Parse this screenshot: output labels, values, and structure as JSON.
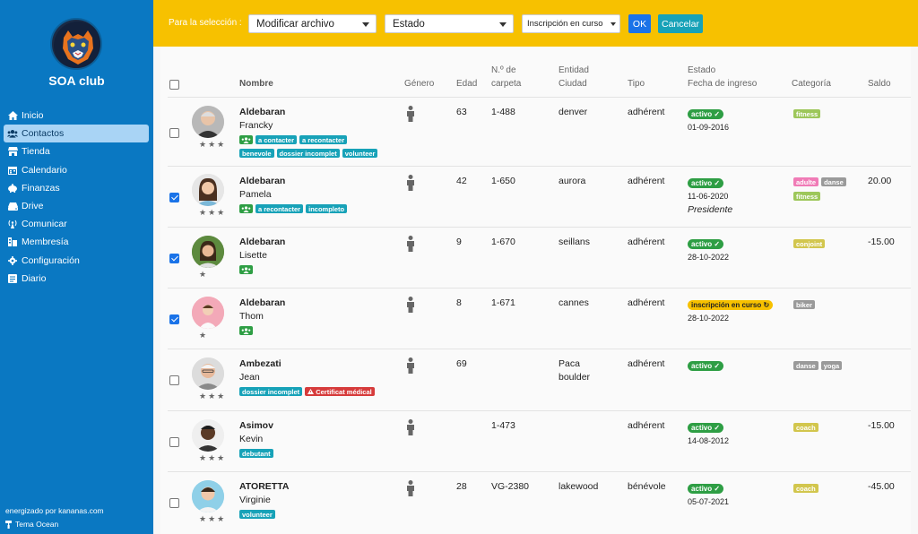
{
  "sidebar": {
    "brand": "SOA club",
    "items": [
      {
        "label": "Inicio",
        "icon": "home-icon"
      },
      {
        "label": "Contactos",
        "icon": "users-icon"
      },
      {
        "label": "Tienda",
        "icon": "store-icon"
      },
      {
        "label": "Calendario",
        "icon": "calendar-icon"
      },
      {
        "label": "Finanzas",
        "icon": "piggy-bank-icon"
      },
      {
        "label": "Drive",
        "icon": "drive-icon"
      },
      {
        "label": "Comunicar",
        "icon": "broadcast-icon"
      },
      {
        "label": "Membresía",
        "icon": "membership-icon"
      },
      {
        "label": "Configuración",
        "icon": "gear-icon"
      },
      {
        "label": "Diario",
        "icon": "journal-icon"
      }
    ],
    "footer_powered": "energizado por kananas.com",
    "footer_theme": "Tema Ocean"
  },
  "toolbar": {
    "selection_label": "Para la selección :",
    "action_select": "Modificar archivo",
    "field_select": "Estado",
    "value_select": "Inscripción en curso",
    "ok_label": "OK",
    "cancel_label": "Cancelar"
  },
  "table": {
    "headers": {
      "nombre": "Nombre",
      "genero": "Género",
      "edad": "Edad",
      "carpeta1": "N.º de",
      "carpeta2": "carpeta",
      "entidad1": "Entidad",
      "entidad2": "Ciudad",
      "tipo": "Tipo",
      "estado1": "Estado",
      "estado2": "Fecha de ingreso",
      "categoria": "Categoría",
      "saldo": "Saldo"
    },
    "rows": [
      {
        "last": "Aldebaran",
        "first": "Francky",
        "stars": "★★★",
        "age": "63",
        "folder": "1-488",
        "city": "denver",
        "city2": "",
        "type": "adhérent",
        "status": "activo ✓",
        "date": "01-09-2016",
        "role": "",
        "balance": "",
        "tags_l1": [
          "a contacter",
          "a recontacter"
        ],
        "tags_l2": [
          "benevole",
          "dossier incomplet",
          "volunteer"
        ],
        "cats": [
          "fitness"
        ]
      },
      {
        "last": "Aldebaran",
        "first": "Pamela",
        "stars": "★★★",
        "age": "42",
        "folder": "1-650",
        "city": "aurora",
        "city2": "",
        "type": "adhérent",
        "status": "activo ✓",
        "date": "11-06-2020",
        "role": "Presidente",
        "balance": "20.00",
        "tags_l1": [
          "a recontacter",
          "incompleto"
        ],
        "tags_l2": [],
        "cats": [
          "adulte",
          "danse",
          "fitness"
        ]
      },
      {
        "last": "Aldebaran",
        "first": "Lisette",
        "stars": "★",
        "age": "9",
        "folder": "1-670",
        "city": "seillans",
        "city2": "",
        "type": "adhérent",
        "status": "activo ✓",
        "date": "28-10-2022",
        "role": "",
        "balance": "-15.00",
        "tags_l1": [],
        "tags_l2": [],
        "cats": [
          "conjoint"
        ]
      },
      {
        "last": "Aldebaran",
        "first": "Thom",
        "stars": "★",
        "age": "8",
        "folder": "1-671",
        "city": "cannes",
        "city2": "",
        "type": "adhérent",
        "status": "inscripción en curso ↻",
        "date": "28-10-2022",
        "role": "",
        "balance": "",
        "tags_l1": [],
        "tags_l2": [],
        "cats": [
          "biker"
        ]
      },
      {
        "last": "Ambezati",
        "first": "Jean",
        "stars": "★★★",
        "age": "69",
        "folder": "",
        "city": "Paca",
        "city2": "boulder",
        "type": "adhérent",
        "status": "activo ✓",
        "date": "",
        "role": "",
        "balance": "",
        "tags_l1": [
          "dossier incomplet",
          "Certificat médical"
        ],
        "tags_l2": [],
        "cats": [
          "danse",
          "yoga"
        ]
      },
      {
        "last": "Asimov",
        "first": "Kevin",
        "stars": "★★★",
        "age": "",
        "folder": "1-473",
        "city": "",
        "city2": "",
        "type": "adhérent",
        "status": "activo ✓",
        "date": "14-08-2012",
        "role": "",
        "balance": "-15.00",
        "tags_l1": [
          "debutant"
        ],
        "tags_l2": [],
        "cats": [
          "coach"
        ]
      },
      {
        "last": "ATORETTA",
        "first": "Virginie",
        "stars": "★★★",
        "age": "28",
        "folder": "VG-2380",
        "city": "lakewood",
        "city2": "",
        "type": "bénévole",
        "status": "activo ✓",
        "date": "05-07-2021",
        "role": "",
        "balance": "-45.00",
        "tags_l1": [
          "volunteer"
        ],
        "tags_l2": [],
        "cats": [
          "coach"
        ]
      }
    ]
  },
  "colors": {
    "sidebar": "#0a78c2",
    "topbar": "#f7c100",
    "ok": "#1a73e8",
    "cancel": "#17a2b8",
    "active": "#2e9e44"
  }
}
